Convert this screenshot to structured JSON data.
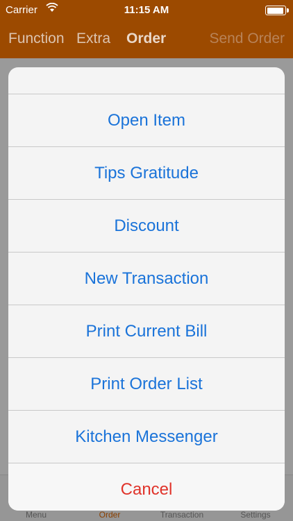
{
  "status_bar": {
    "carrier": "Carrier",
    "time": "11:15 AM",
    "battery_level": 0.95
  },
  "nav": {
    "function_label": "Function",
    "extra_label": "Extra",
    "order_label": "Order",
    "send_label": "Send Order"
  },
  "action_sheet": {
    "items": [
      "Open Item",
      "Tips Gratitude",
      "Discount",
      "New Transaction",
      "Print Current Bill",
      "Print Order List",
      "Kitchen Messenger"
    ],
    "cancel_label": "Cancel"
  },
  "tabs": [
    "Menu",
    "Order",
    "Transaction",
    "Settings"
  ],
  "active_tab": "Order",
  "colors": {
    "nav_bg": "#9c4a00",
    "action_text": "#1a73d9",
    "cancel_text": "#e0332a"
  }
}
